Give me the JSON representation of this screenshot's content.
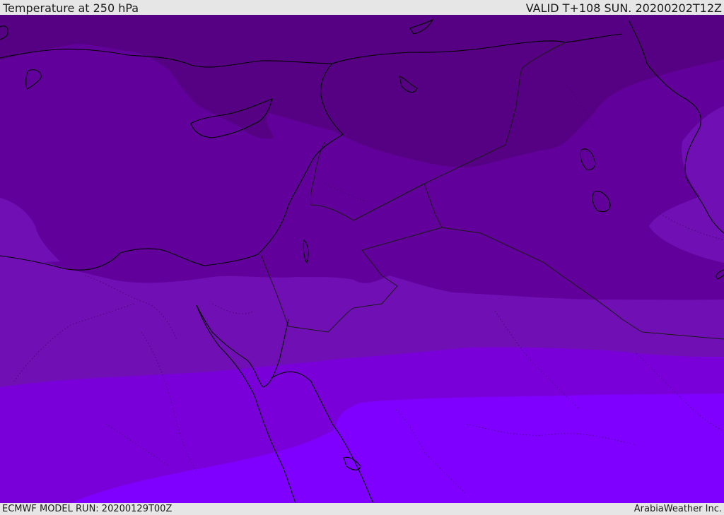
{
  "header": {
    "title": "Temperature at 250 hPa",
    "valid": "VALID T+108 SUN. 20200202T12Z"
  },
  "footer": {
    "model_run": "ECMWF MODEL RUN: 20200129T00Z",
    "credit": "ArabiaWeather Inc."
  },
  "colors": {
    "band_coldest": "#560083",
    "band_cold": "#62009b",
    "band_mid": "#7010b4",
    "band_warm": "#7a00da",
    "band_warmest": "#7f00ff",
    "coastline": "#000000",
    "border": "#1a1a1a"
  }
}
